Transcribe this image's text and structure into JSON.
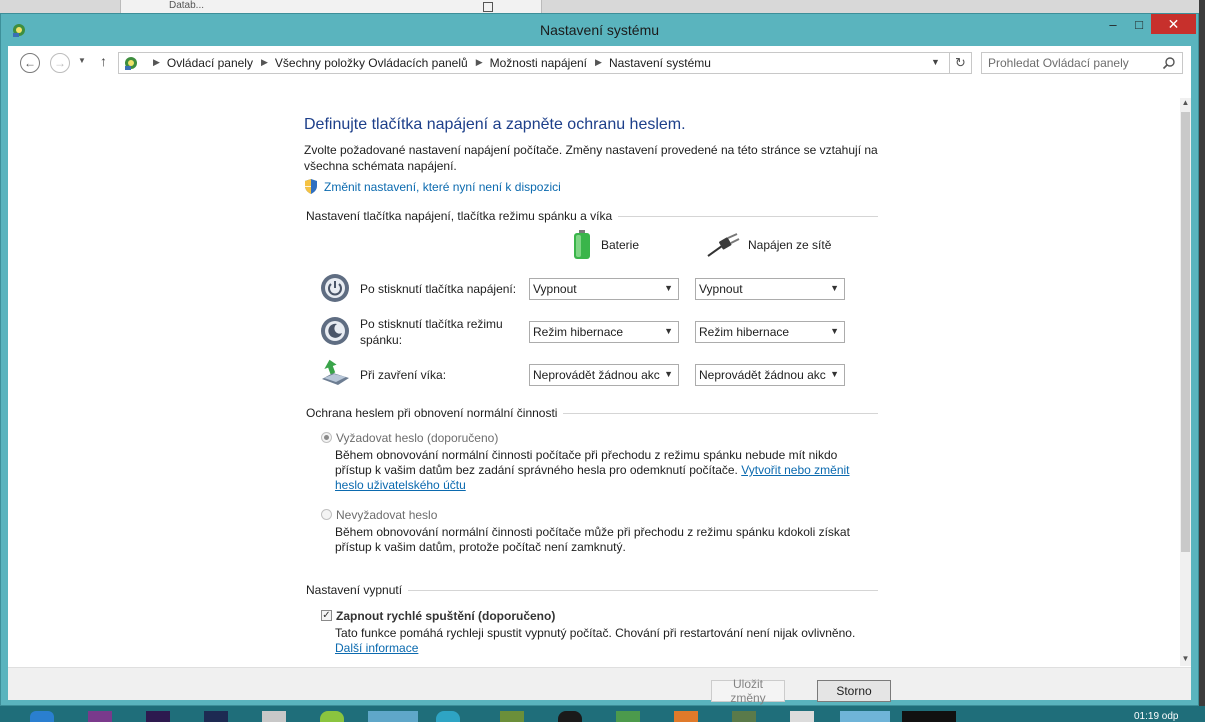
{
  "background": {
    "window_title_fragment": "Datab..."
  },
  "window": {
    "title": "Nastavení systému",
    "minimize_label": "–",
    "maximize_label": "□",
    "close_label": "✕"
  },
  "address_bar": {
    "crumbs": [
      "Ovládací panely",
      "Všechny položky Ovládacích panelů",
      "Možnosti napájení",
      "Nastavení systému"
    ],
    "search_placeholder": "Prohledat Ovládací panely"
  },
  "main": {
    "heading": "Definujte tlačítka napájení a zapněte ochranu heslem.",
    "description": "Zvolte požadované nastavení napájení počítače. Změny nastavení provedené na této stránce se vztahují na všechna schémata napájení.",
    "change_settings_link": "Změnit nastavení, které nyní není k dispozici",
    "power_section": {
      "title": "Nastavení tlačítka napájení, tlačítka režimu spánku a víka",
      "col_battery": "Baterie",
      "col_plugged": "Napájen ze sítě",
      "rows": [
        {
          "label": "Po stisknutí tlačítka napájení:",
          "battery": "Vypnout",
          "plugged": "Vypnout"
        },
        {
          "label": "Po stisknutí tlačítka režimu spánku:",
          "battery": "Režim hibernace",
          "plugged": "Režim hibernace"
        },
        {
          "label": "Při zavření víka:",
          "battery": "Neprovádět žádnou akc",
          "plugged": "Neprovádět žádnou akc"
        }
      ]
    },
    "password_section": {
      "title": "Ochrana heslem při obnovení normální činnosti",
      "require": {
        "label": "Vyžadovat heslo (doporučeno)",
        "text": "Během obnovování normální činnosti počítače při přechodu z režimu spánku nebude mít nikdo přístup k vašim datům bez zadání správného hesla pro odemknutí počítače.",
        "link": "Vytvořit nebo změnit heslo uživatelského účtu",
        "selected": true
      },
      "no_require": {
        "label": "Nevyžadovat heslo",
        "text": "Během obnovování normální činnosti počítače může při přechodu z režimu spánku kdokoli získat přístup k vašim datům, protože počítač není zamknutý.",
        "selected": false
      }
    },
    "shutdown_section": {
      "title": "Nastavení vypnutí",
      "fast_startup": {
        "label": "Zapnout rychlé spuštění (doporučeno)",
        "checked": true,
        "text": "Tato funkce pomáhá rychleji spustit vypnutý počítač. Chování při restartování není nijak ovlivněno.",
        "link": "Další informace"
      }
    }
  },
  "footer": {
    "save_label": "Uložit změny",
    "cancel_label": "Storno"
  },
  "taskbar": {
    "clock": "01:19 odp"
  },
  "colors": {
    "title_bar": "#5ab4be",
    "close_button": "#c7302c",
    "heading": "#1d3f8a",
    "link": "#0b6aaf",
    "taskbar": "#1f6e7a"
  }
}
